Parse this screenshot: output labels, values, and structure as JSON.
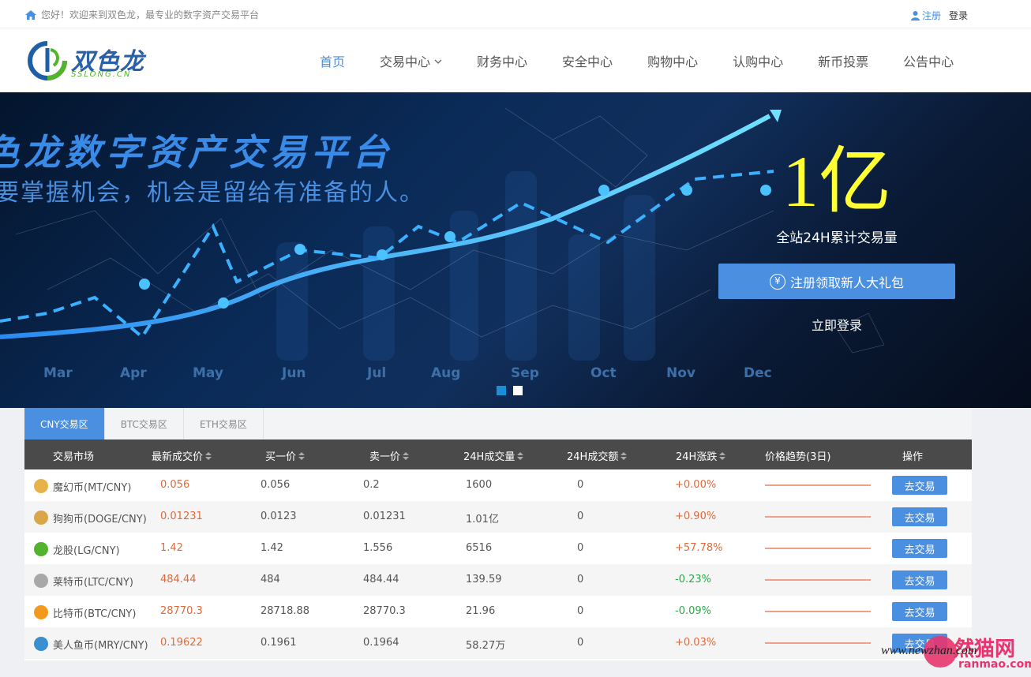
{
  "topbar": {
    "welcome": "您好！欢迎来到双色龙，最专业的数字资产交易平台",
    "register": "注册",
    "login": "登录"
  },
  "logo": {
    "brand": "双色龙",
    "domain": "SSLONG.CN"
  },
  "nav": {
    "items": [
      "首页",
      "交易中心",
      "财务中心",
      "安全中心",
      "购物中心",
      "认购中心",
      "新币投票",
      "公告中心"
    ]
  },
  "banner": {
    "headline": "色龙数字资产交易平台",
    "subline": "要掌握机会，机会是留给有准备的人。",
    "months": [
      "Mar",
      "Apr",
      "May",
      "Jun",
      "Jul",
      "Aug",
      "Sep",
      "Oct",
      "Nov",
      "Dec"
    ],
    "stat": "1亿",
    "stat_caption": "全站24H累计交易量",
    "cta_symbol": "¥",
    "cta": "注册领取新人大礼包",
    "signin": "立即登录",
    "slide_count": 2,
    "active_slide": 1
  },
  "market": {
    "tabs": [
      "CNY交易区",
      "BTC交易区",
      "ETH交易区"
    ],
    "active_tab": 0,
    "headers": [
      "交易市场",
      "最新成交价",
      "买一价",
      "卖一价",
      "24H成交量",
      "24H成交额",
      "24H涨跌",
      "价格趋势(3日)",
      "操作"
    ],
    "action_label": "去交易",
    "rows": [
      {
        "name": "魔幻币(MT/CNY)",
        "icon": "mt-coin-icon",
        "icon_color": "#e8b24a",
        "last": "0.056",
        "bid": "0.056",
        "ask": "0.2",
        "volume": "1600",
        "amount": "0",
        "change": "+0.00%",
        "dir": "up"
      },
      {
        "name": "狗狗币(DOGE/CNY)",
        "icon": "doge-coin-icon",
        "icon_color": "#d9a74a",
        "last": "0.01231",
        "bid": "0.0123",
        "ask": "0.01231",
        "volume": "1.01亿",
        "amount": "0",
        "change": "+0.90%",
        "dir": "up"
      },
      {
        "name": "龙股(LG/CNY)",
        "icon": "lg-coin-icon",
        "icon_color": "#52b32c",
        "last": "1.42",
        "bid": "1.42",
        "ask": "1.556",
        "volume": "6516",
        "amount": "0",
        "change": "+57.78%",
        "dir": "up"
      },
      {
        "name": "莱特币(LTC/CNY)",
        "icon": "ltc-coin-icon",
        "icon_color": "#a8a8a8",
        "last": "484.44",
        "bid": "484",
        "ask": "484.44",
        "volume": "139.59",
        "amount": "0",
        "change": "-0.23%",
        "dir": "down"
      },
      {
        "name": "比特币(BTC/CNY)",
        "icon": "btc-coin-icon",
        "icon_color": "#f39a1e",
        "last": "28770.3",
        "bid": "28718.88",
        "ask": "28770.3",
        "volume": "21.96",
        "amount": "0",
        "change": "-0.09%",
        "dir": "down"
      },
      {
        "name": "美人鱼币(MRY/CNY)",
        "icon": "mry-coin-icon",
        "icon_color": "#3a8fd0",
        "last": "0.19622",
        "bid": "0.1961",
        "ask": "0.1964",
        "volume": "58.27万",
        "amount": "0",
        "change": "+0.03%",
        "dir": "up"
      }
    ]
  },
  "watermark": {
    "site": "www.newzhan.com",
    "brand": "然猫网",
    "domain": "ranmao.com"
  },
  "colors": {
    "accent": "#4a8fe0",
    "up": "#e06a3a",
    "down": "#2ea84a",
    "header_bg": "#4a4a4a"
  }
}
